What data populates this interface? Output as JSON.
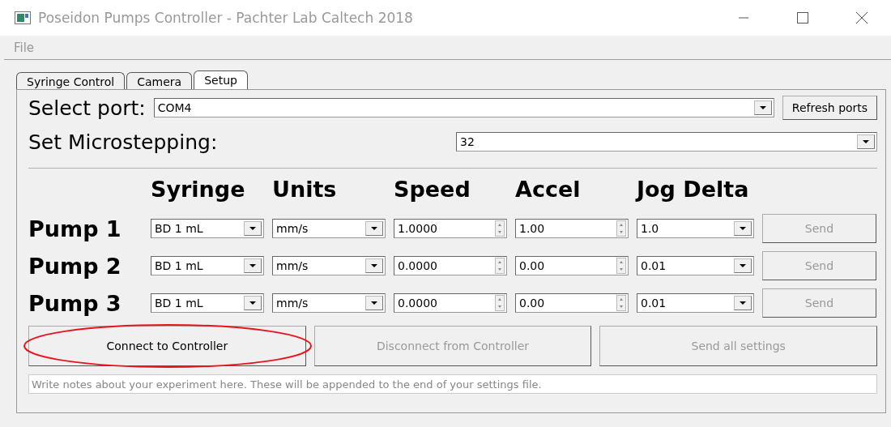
{
  "window": {
    "title": "Poseidon Pumps Controller - Pachter Lab Caltech 2018"
  },
  "menu": [
    "File"
  ],
  "tabs": [
    {
      "label": "Syringe Control",
      "selected": false
    },
    {
      "label": "Camera",
      "selected": false
    },
    {
      "label": "Setup",
      "selected": true
    }
  ],
  "port": {
    "label": "Select port:",
    "value": "COM4",
    "refresh_button": "Refresh ports"
  },
  "microstepping": {
    "label": "Set Microstepping:",
    "value": "32"
  },
  "columns": [
    "Syringe",
    "Units",
    "Speed",
    "Accel",
    "Jog Delta"
  ],
  "pumps": [
    {
      "name": "Pump 1",
      "syringe": "BD 1 mL",
      "units": "mm/s",
      "speed": "1.0000",
      "accel": "1.00",
      "jog_delta": "1.0",
      "send": "Send",
      "send_disabled": true
    },
    {
      "name": "Pump 2",
      "syringe": "BD 1 mL",
      "units": "mm/s",
      "speed": "0.0000",
      "accel": "0.00",
      "jog_delta": "0.01",
      "send": "Send",
      "send_disabled": true
    },
    {
      "name": "Pump 3",
      "syringe": "BD 1 mL",
      "units": "mm/s",
      "speed": "0.0000",
      "accel": "0.00",
      "jog_delta": "0.01",
      "send": "Send",
      "send_disabled": true
    }
  ],
  "actions": [
    {
      "label": "Connect to Controller",
      "disabled": false,
      "highlighted": true
    },
    {
      "label": "Disconnect from Controller",
      "disabled": true,
      "highlighted": false
    },
    {
      "label": "Send all settings",
      "disabled": true,
      "highlighted": false
    }
  ],
  "notes": {
    "placeholder": "Write notes about your experiment here. These will be appended to the end of your settings file."
  }
}
